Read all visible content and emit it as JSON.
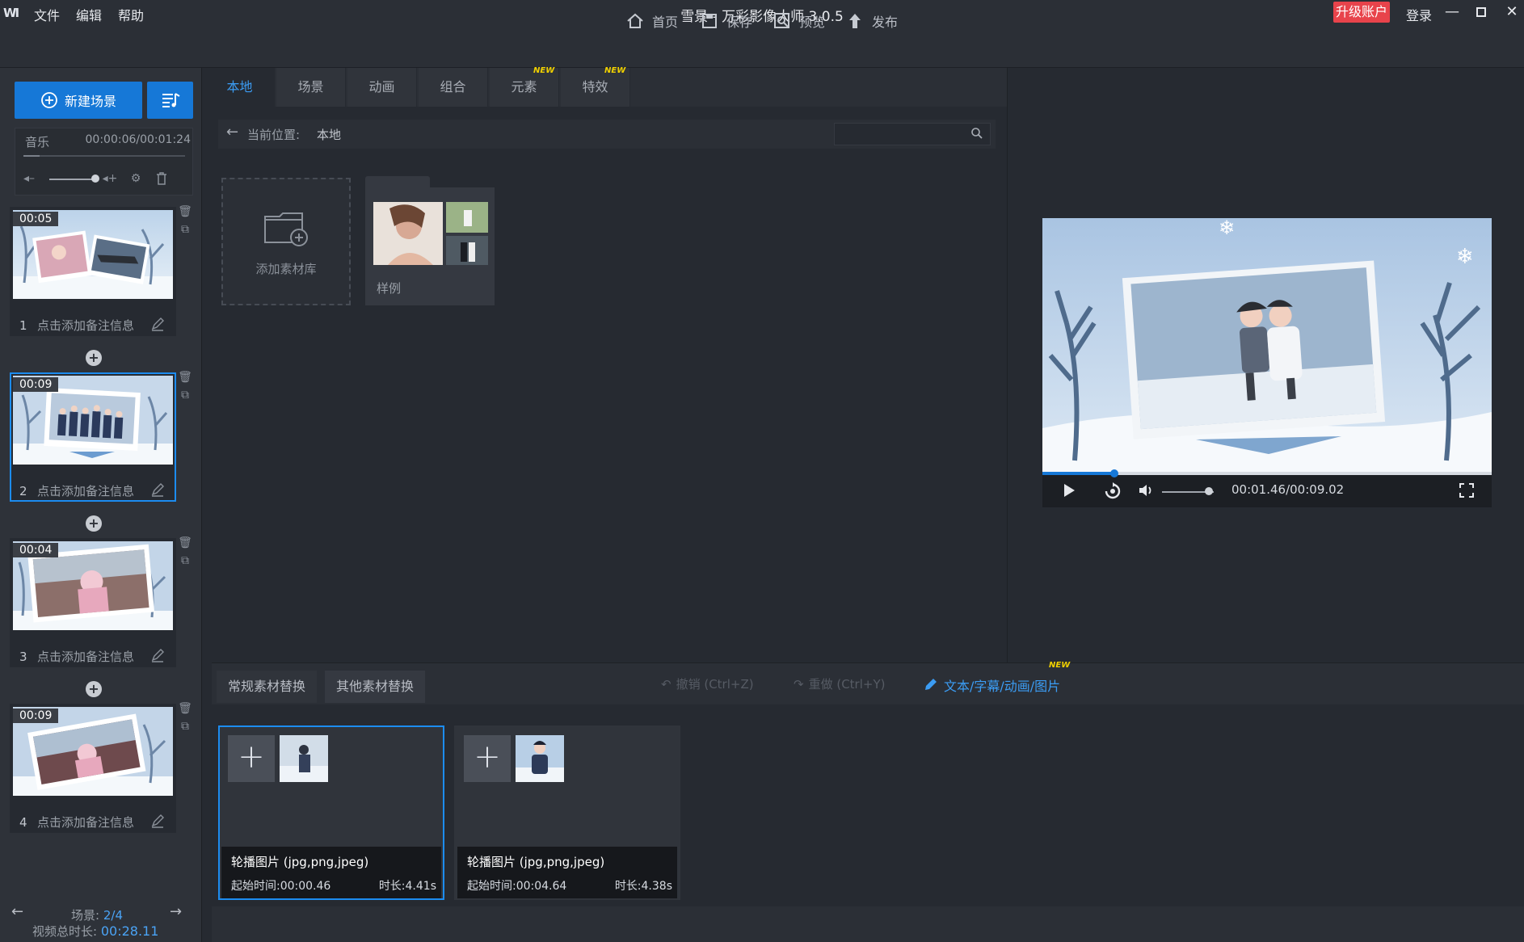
{
  "app": {
    "logo": "WI",
    "title": "雪景 - 万彩影像大师 3.0.5",
    "menu": [
      "文件",
      "编辑",
      "帮助"
    ],
    "upgrade": "升级账户",
    "login": "登录"
  },
  "toolbar": {
    "home": "首页",
    "save": "保存",
    "preview": "预览",
    "publish": "发布"
  },
  "left": {
    "new_scene": "新建场景",
    "music_label": "音乐",
    "music_time": "00:00:06/00:01:24",
    "scenes": [
      {
        "index": "1",
        "time": "00:05",
        "note": "点击添加备注信息"
      },
      {
        "index": "2",
        "time": "00:09",
        "note": "点击添加备注信息"
      },
      {
        "index": "3",
        "time": "00:04",
        "note": "点击添加备注信息"
      },
      {
        "index": "4",
        "time": "00:09",
        "note": "点击添加备注信息"
      }
    ],
    "selected_scene": 2,
    "scene_count_label": "场景:",
    "scene_count_value": "2/4",
    "total_duration_label": "视频总时长:",
    "total_duration_value": "00:28.11"
  },
  "resources": {
    "tabs": [
      {
        "label": "本地",
        "new": false
      },
      {
        "label": "场景",
        "new": false
      },
      {
        "label": "动画",
        "new": false
      },
      {
        "label": "组合",
        "new": false
      },
      {
        "label": "元素",
        "new": true
      },
      {
        "label": "特效",
        "new": true
      }
    ],
    "active_tab": "本地",
    "new_badge": "NEW",
    "breadcrumb_label": "当前位置:",
    "breadcrumb_value": "本地",
    "search_placeholder": "",
    "add_library": "添加素材库",
    "sample_folder": "样例"
  },
  "preview": {
    "time": "00:01.46/00:09.02",
    "progress": 0.16,
    "volume": 0.9
  },
  "bottom": {
    "tabs": [
      "常规素材替换",
      "其他素材替换"
    ],
    "undo": "撤销 (Ctrl+Z)",
    "redo": "重做 (Ctrl+Y)",
    "text_edit": "文本/字幕/动画/图片",
    "text_edit_new": "NEW",
    "cards": [
      {
        "type": "轮播图片 (jpg,png,jpeg)",
        "start": "起始时间:00:00.46",
        "duration": "时长:4.41s"
      },
      {
        "type": "轮播图片 (jpg,png,jpeg)",
        "start": "起始时间:00:04.64",
        "duration": "时长:4.38s"
      }
    ]
  },
  "colors": {
    "accent": "#1678d7",
    "upgrade": "#e8434b",
    "bg": "#262a31",
    "new_badge": "#f0d000"
  }
}
